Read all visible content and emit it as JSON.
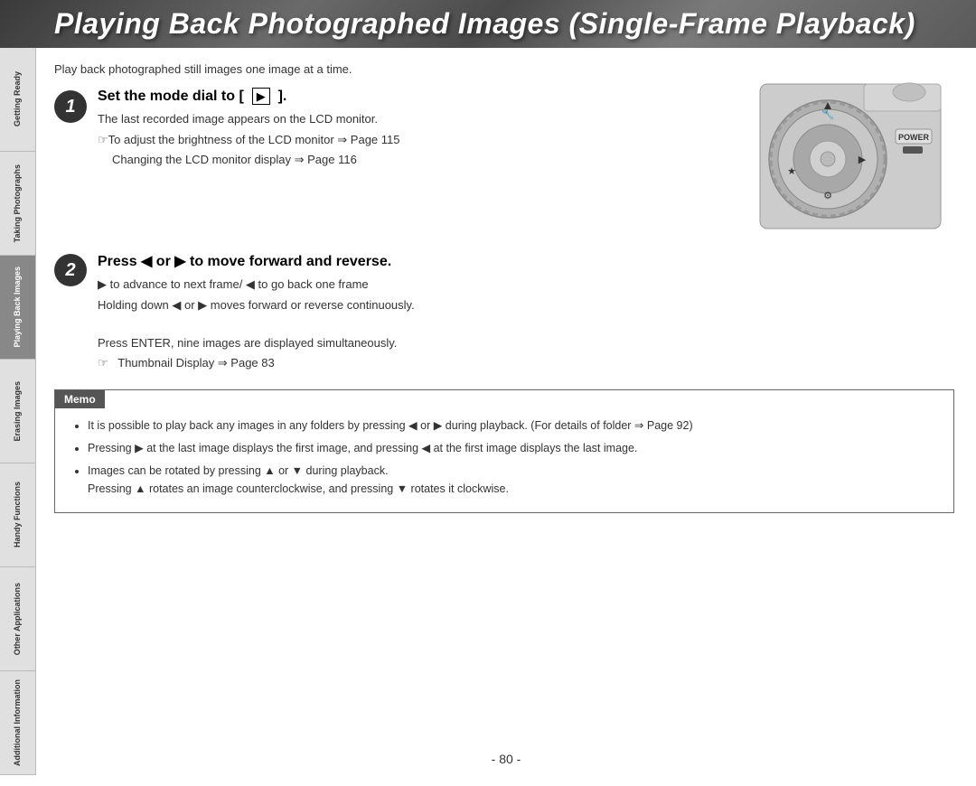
{
  "header": {
    "title": "Playing Back Photographed Images (Single-Frame Playback)"
  },
  "intro": {
    "text": "Play back photographed still images one image at a time."
  },
  "step1": {
    "number": "1",
    "title": "Set the mode dial to [  ▶  ].",
    "lines": [
      "The last recorded image appears on the LCD monitor.",
      "☞ To adjust the brightness of the LCD monitor ⇒ Page 115",
      "Changing the LCD monitor display ⇒ Page 116"
    ]
  },
  "step2": {
    "number": "2",
    "title": "Press ◀ or ▶ to move forward and reverse.",
    "lines": [
      "▶ to advance to next frame/ ◀ to go back one frame",
      "Holding down ◀ or ▶ moves forward or reverse continuously.",
      "",
      "Press ENTER, nine images are displayed simultaneously.",
      "☞   Thumbnail Display ⇒ Page 83"
    ]
  },
  "memo": {
    "header": "Memo",
    "bullets": [
      "It is possible to play back any images in any folders by pressing ◀ or ▶ during playback. (For details of folder  ⇒ Page 92)",
      "Pressing ▶ at the last image displays the first image, and pressing ◀ at the first image displays the last image.",
      "Images can be rotated by pressing ▲ or ▼ during playback.\nPressing ▲ rotates an image counterclockwise, and pressing ▼ rotates it clockwise."
    ]
  },
  "sidebar": {
    "items": [
      {
        "label": "Getting\nReady",
        "active": false
      },
      {
        "label": "Taking\nPhotographs",
        "active": false
      },
      {
        "label": "Playing\nBack Images",
        "active": true
      },
      {
        "label": "Erasing\nImages",
        "active": false
      },
      {
        "label": "Handy\nFunctions",
        "active": false
      },
      {
        "label": "Other\nApplications",
        "active": false
      },
      {
        "label": "Additional\nInformation",
        "active": false
      }
    ]
  },
  "page_number": "- 80 -",
  "camera": {
    "power_label": "POWER"
  }
}
